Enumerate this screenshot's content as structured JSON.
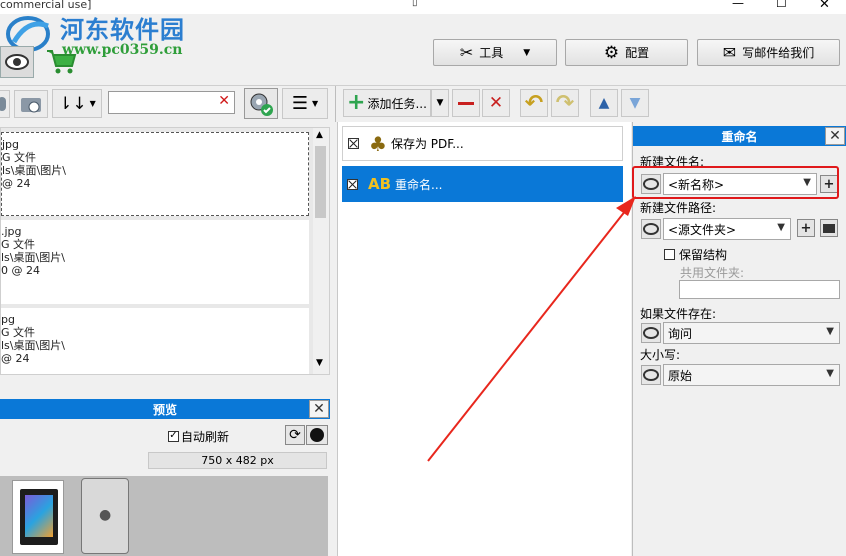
{
  "window": {
    "title_fragment": "commercial use]",
    "controls": [
      "—",
      "☐",
      "✕"
    ]
  },
  "watermark": {
    "site_name": "河东软件园",
    "url": "www.pc0359.cn"
  },
  "header_buttons": {
    "tools": "工具",
    "settings": "配置",
    "email": "写邮件给我们"
  },
  "left_toolbar": {
    "search_value": "",
    "clear_symbol": "✕"
  },
  "files": [
    {
      "name": "jpg",
      "type": "G 文件",
      "path": "ls\\桌面\\图片\\",
      "info": "@ 24"
    },
    {
      "name": ".jpg",
      "type": "G 文件",
      "path": "ls\\桌面\\图片\\",
      "info": "0 @ 24"
    },
    {
      "name": "pg",
      "type": "G 文件",
      "path": "ls\\桌面\\图片\\",
      "info": "@ 24"
    }
  ],
  "preview": {
    "title": "预览",
    "auto_refresh": "自动刷新",
    "dimensions": "750 x 482 px"
  },
  "tasks_toolbar": {
    "add_task": "添加任务..."
  },
  "tasks": [
    {
      "label": "保存为 PDF...",
      "selected": false
    },
    {
      "label": "重命名...",
      "selected": true
    }
  ],
  "rename_panel": {
    "title": "重命名",
    "new_filename_label": "新建文件名:",
    "new_filename_value": "<新名称>",
    "new_path_label": "新建文件路径:",
    "new_path_value": "<源文件夹>",
    "keep_structure": "保留结构",
    "shared_folder_label": "共用文件夹:",
    "shared_folder_value": "",
    "if_exists_label": "如果文件存在:",
    "if_exists_value": "询问",
    "case_label": "大小写:",
    "case_value": "原始"
  },
  "colors": {
    "accent": "#0a78d7",
    "highlight_box": "#e0191b",
    "arrow": "#e8271d"
  }
}
